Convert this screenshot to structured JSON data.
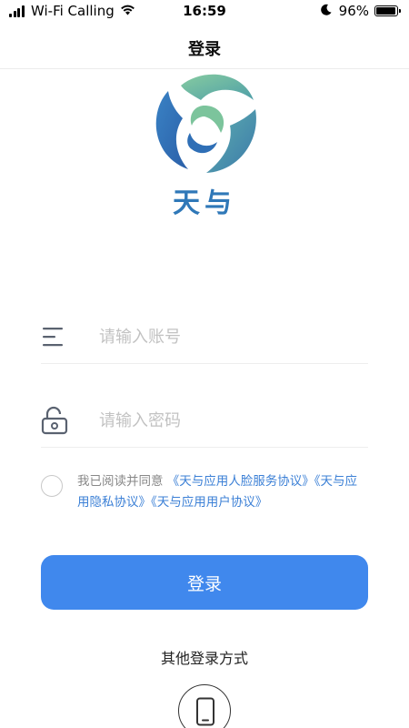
{
  "status_bar": {
    "carrier": "Wi-Fi Calling",
    "time": "16:59",
    "battery": "96%",
    "battery_level": 0.96,
    "icons": [
      "signal-icon",
      "wifi-icon",
      "moon-icon",
      "battery-icon"
    ]
  },
  "nav": {
    "title": "登录"
  },
  "brand": {
    "name": "天与",
    "logo_icon": "tianyu-logo-icon"
  },
  "form": {
    "account": {
      "placeholder": "请输入账号",
      "value": "",
      "icon": "account-lines-icon"
    },
    "password": {
      "placeholder": "请输入密码",
      "value": "",
      "icon": "unlocked-padlock-icon"
    }
  },
  "agreement": {
    "prefix": "我已阅读并同意",
    "link_face_service": "《天与应用人脸服务协议》",
    "link_privacy": "《天与应用隐私协议》",
    "link_user": "《天与应用用户协议》",
    "checked": false
  },
  "login_button": {
    "label": "登录"
  },
  "other_login": {
    "label": "其他登录方式",
    "phone_icon": "phone-icon"
  },
  "colors": {
    "primary": "#4088ed",
    "link": "#3c80d6",
    "brand_text": "#2f78b8",
    "logo_green": "#7cc49c",
    "logo_blue": "#2f6fb6",
    "placeholder": "#c2c2c2"
  }
}
